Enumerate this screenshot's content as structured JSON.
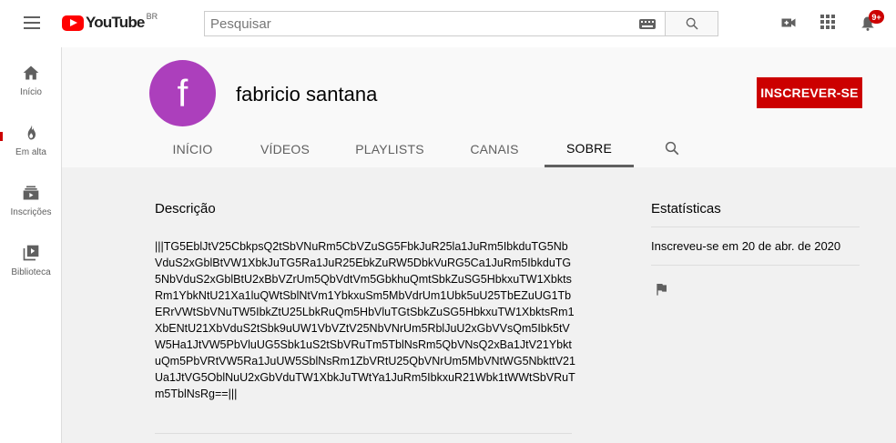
{
  "header": {
    "logo_text": "YouTube",
    "logo_country": "BR",
    "search_placeholder": "Pesquisar",
    "notification_count": "9+"
  },
  "sidebar": {
    "items": [
      {
        "label": "Início",
        "icon": "home-icon"
      },
      {
        "label": "Em alta",
        "icon": "flame-icon"
      },
      {
        "label": "Inscrições",
        "icon": "subscriptions-icon"
      },
      {
        "label": "Biblioteca",
        "icon": "library-icon"
      }
    ]
  },
  "channel": {
    "avatar_letter": "f",
    "avatar_color": "#ac3fbc",
    "name": "fabricio santana",
    "subscribe_label": "INSCREVER-SE",
    "subscribe_color": "#cc0000"
  },
  "tabs": [
    {
      "label": "INÍCIO",
      "active": false
    },
    {
      "label": "VÍDEOS",
      "active": false
    },
    {
      "label": "PLAYLISTS",
      "active": false
    },
    {
      "label": "CANAIS",
      "active": false
    },
    {
      "label": "SOBRE",
      "active": true
    }
  ],
  "about": {
    "description_title": "Descrição",
    "description_text": "|||TG5EblJtV25CbkpsQ2tSbVNuRm5CbVZuSG5FbkJuR25la1JuRm5IbkduTG5NbVduS2xGblBtVW1XbkJuTG5Ra1JuR25EbkZuRW5DbkVuRG5Ca1JuRm5IbkduTG5NbVduS2xGblBtU2xBbVZrUm5QbVdtVm5GbkhuQmtSbkZuSG5HbkxuTW1XbktsRm1YbkNtU21Xa1luQWtSblNtVm1YbkxuSm5MbVdrUm1Ubk5uU25TbEZuUG1TbERrVWtSbVNuTW5IbkZtU25LbkRuQm5HbVluTGtSbkZuSG5HbkxuTW1XbktsRm1XbENtU21XbVduS2tSbk9uUW1VbVZtV25NbVNrUm5RblJuU2xGbVVsQm5Ibk5tVW5Ha1JtVW5PbVluUG5Sbk1uS2tSbVRuTm5TblNsRm5QbVNsQ2xBa1JtV21YbktuQm5PbVRtVW5Ra1JuUW5SblNsRm1ZbVRtU25QbVNrUm5MbVNtWG5NbkttV21Ua1JtVG5OblNuU2xGbVduTW1XbkJuTWtYa1JuRm5IbkxuR21Wbk1tWWtSbVRuTm5TblNsRg==|||",
    "stats_title": "Estatísticas",
    "joined_text": "Inscreveu-se em 20 de abr. de 2020"
  }
}
